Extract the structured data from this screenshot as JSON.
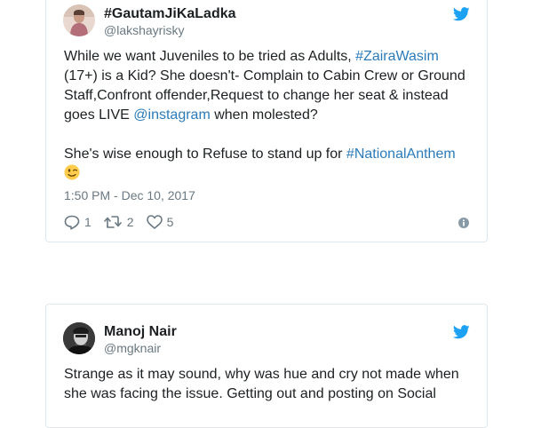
{
  "tweets": [
    {
      "display_name": "#GautamJiKaLadka",
      "screen_name": "@lakshayrisky",
      "icons": {
        "avatar": "avatar-photo",
        "brand": "twitter-bird-icon",
        "reply": "reply-icon",
        "retweet": "retweet-icon",
        "like": "heart-icon",
        "info": "info-icon",
        "emoji": "winking-face-emoji"
      },
      "text": {
        "line1_pre": "While we want Juveniles to be tried as Adults, ",
        "hashtag_zaira": "#ZairaWasim",
        "line2": "(17+) is a Kid? She doesn't- Complain to Cabin Crew or Ground",
        "line3": "Staff,Confront offender,Request to change her seat & instead",
        "line4_pre": "goes LIVE ",
        "mention_instagram": "@instagram",
        "line4_post": " when molested?",
        "line5_pre": "She's wise enough to Refuse to stand up for ",
        "hashtag_anthem": "#NationalAnthem"
      },
      "timestamp": "1:50 PM - Dec 10, 2017",
      "reply_count": "1",
      "retweet_count": "2",
      "like_count": "5"
    },
    {
      "display_name": "Manoj Nair",
      "screen_name": "@mgknair",
      "icons": {
        "avatar": "avatar-photo",
        "brand": "twitter-bird-icon"
      },
      "text": {
        "line1": "Strange as it may sound, why was hue and cry not made when",
        "line2": "she was facing the issue. Getting out and posting on Social"
      }
    }
  ],
  "colors": {
    "link": "#2b7bb9",
    "twitter_blue": "#1da1f2",
    "text": "#1c2022",
    "muted": "#697882",
    "border": "#e1e8ed"
  }
}
